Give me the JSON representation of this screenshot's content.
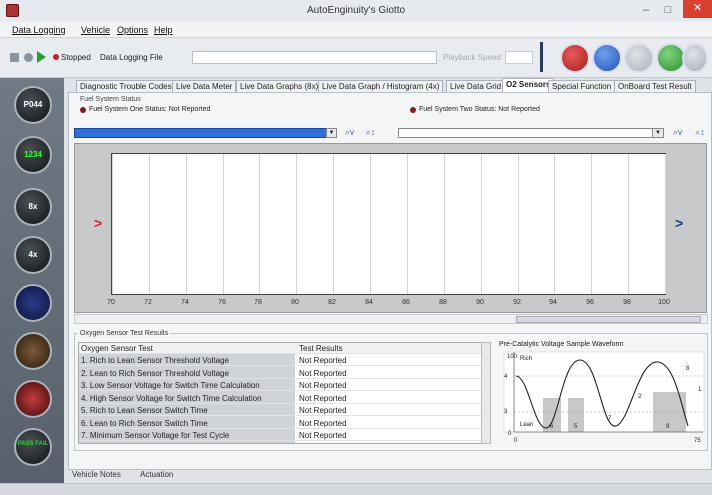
{
  "window": {
    "title": "AutoEnginuity's Giotto",
    "minimize": "–",
    "maximize": "□",
    "close": "✕"
  },
  "menu": [
    "Data Logging",
    "Vehicle",
    "Options",
    "Help"
  ],
  "toolbar": {
    "stopped_label": "Stopped",
    "data_logging_file_label": "Data Logging File",
    "file_value": "",
    "playback_speed_label": "Playback Speed",
    "big_buttons": [
      {
        "name": "record-red",
        "color": "#cc2b2b"
      },
      {
        "name": "refresh-blue",
        "color": "#3b6fd1"
      },
      {
        "name": "disabled-gray",
        "color": "#b8bec6"
      },
      {
        "name": "go-green",
        "color": "#3aa53a"
      },
      {
        "name": "cancel-gray",
        "color": "#b8bec6"
      }
    ]
  },
  "sidebar": [
    {
      "name": "obd-p0440",
      "label": "P044"
    },
    {
      "name": "live-meter",
      "label": "1234"
    },
    {
      "name": "graphs-8x",
      "label": "8x"
    },
    {
      "name": "graph-4x",
      "label": "4x"
    },
    {
      "name": "data-grid",
      "label": ""
    },
    {
      "name": "o2-sensors",
      "label": ""
    },
    {
      "name": "special-function",
      "label": ""
    },
    {
      "name": "pass-fail",
      "label": "PASS FAIL"
    }
  ],
  "tabs": [
    {
      "label": "Diagnostic Trouble Codes",
      "active": false
    },
    {
      "label": "Live Data Meter",
      "active": false
    },
    {
      "label": "Live Data Graphs (8x)",
      "active": false
    },
    {
      "label": "Live Data Graph / Histogram (4x)",
      "active": false
    },
    {
      "label": "Live Data Grid",
      "active": false
    },
    {
      "label": "O2 Sensors",
      "active": true
    },
    {
      "label": "Special Function",
      "active": false
    },
    {
      "label": "OnBoard Test Result",
      "active": false
    }
  ],
  "fuel_system": {
    "heading": "Fuel System Status",
    "one": "Fuel System One Status:  Not Reported",
    "two": "Fuel System Two Status:  Not Reported"
  },
  "selectors": {
    "left": "",
    "right": "",
    "zoom_label": "⌕v",
    "fit_label": "⌕↕"
  },
  "graph": {
    "x_ticks": [
      "70",
      "72",
      "74",
      "76",
      "78",
      "80",
      "82",
      "84",
      "86",
      "88",
      "90",
      "92",
      "94",
      "96",
      "98",
      "100"
    ],
    "left_arrow": ">",
    "right_arrow": ">"
  },
  "results": {
    "group_label": "Oxygen Sensor Test Results",
    "columns": [
      "Oxygen Sensor Test",
      "Test Results"
    ],
    "rows": [
      [
        "1. Rich to Lean Sensor Threshold Voltage",
        "Not Reported"
      ],
      [
        "2. Lean to Rich Sensor Threshold Voltage",
        "Not Reported"
      ],
      [
        "3. Low Sensor Voltage for Switch Time Calculation",
        "Not Reported"
      ],
      [
        "4. High Sensor Voltage for Switch Time Calculation",
        "Not Reported"
      ],
      [
        "5. Rich to Lean Sensor Switch Time",
        "Not Reported"
      ],
      [
        "6. Lean to Rich Sensor Switch Time",
        "Not Reported"
      ],
      [
        "7. Minimum Sensor Voltage for Test Cycle",
        "Not Reported"
      ]
    ]
  },
  "waveform": {
    "title": "Pre-Catalytic Voltage Sample Waveform",
    "rich": "Rich",
    "lean": "Lean",
    "y_top": "100",
    "y_bottom": "0",
    "x_left": "0",
    "x_right": "75",
    "markers": [
      "1",
      "2",
      "3",
      "4",
      "5",
      "6",
      "7",
      "8",
      "9"
    ]
  },
  "bottom_tabs": [
    "Vehicle Notes",
    "Actuation"
  ]
}
